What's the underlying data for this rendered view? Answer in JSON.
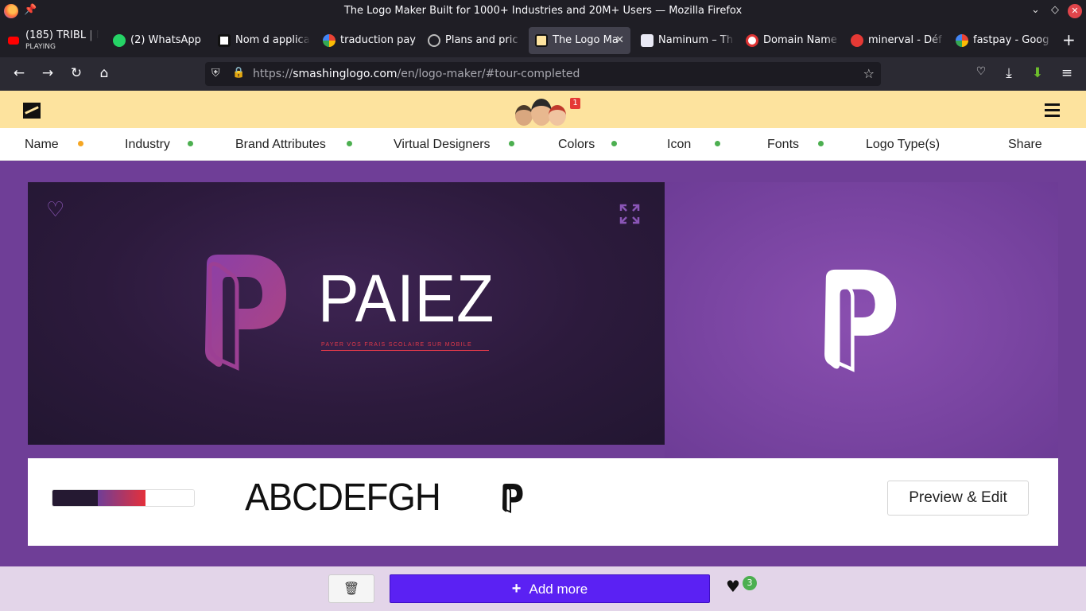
{
  "window": {
    "title": "The Logo Maker Built for 1000+ Industries and 20M+ Users — Mozilla Firefox",
    "controls": [
      "chevron-down",
      "restore",
      "close"
    ]
  },
  "tabs": [
    {
      "label": "(185) TRIBL | N",
      "sub": "PLAYING",
      "favicon": "youtube-icon",
      "color": "#ff0000"
    },
    {
      "label": "(2) WhatsApp",
      "favicon": "whatsapp-icon",
      "color": "#25d366"
    },
    {
      "label": "Nom d applica",
      "favicon": "app-icon",
      "color": "#ffffff"
    },
    {
      "label": "traduction pay",
      "favicon": "google-icon",
      "color": "#4285f4"
    },
    {
      "label": "Plans and pric",
      "favicon": "plans-icon",
      "color": "#333333"
    },
    {
      "label": "The Logo Ma",
      "favicon": "smashinglogo-icon",
      "color": "#fde39e",
      "active": true
    },
    {
      "label": "Naminum – Th",
      "favicon": "naminum-icon",
      "color": "#e9e9f5"
    },
    {
      "label": "Domain Name",
      "favicon": "domain-icon",
      "color": "#ffffff"
    },
    {
      "label": "minerval - Déf",
      "favicon": "minerval-icon",
      "color": "#e53935"
    },
    {
      "label": "fastpay - Goog",
      "favicon": "google-icon",
      "color": "#4285f4"
    }
  ],
  "url": {
    "prefix": "https://",
    "domain": "smashinglogo.com",
    "path": "/en/logo-maker/#tour-completed"
  },
  "header": {
    "notification_count": "1"
  },
  "steps": [
    {
      "label": "Name",
      "dot": "#f5a623"
    },
    {
      "label": "Industry",
      "dot": "#4caf50"
    },
    {
      "label": "Brand Attributes",
      "dot": "#4caf50"
    },
    {
      "label": "Virtual Designers",
      "dot": "#4caf50"
    },
    {
      "label": "Colors",
      "dot": "#4caf50"
    },
    {
      "label": "Icon",
      "dot": "#4caf50"
    },
    {
      "label": "Fonts",
      "dot": "#4caf50"
    },
    {
      "label": "Logo Type(s)",
      "dot": null
    },
    {
      "label": "Share",
      "dot": null
    }
  ],
  "logo": {
    "brand_name": "PAIEZ",
    "tagline": "PAYER VOS FRAIS SCOLAIRE SUR MOBILE"
  },
  "colors": {
    "accent_purple": "#6f3e97",
    "palette": [
      "#251932",
      "#9b2c6f",
      "#e4303a",
      "#ffffff"
    ]
  },
  "details": {
    "font_sample": "ABCDEFGH",
    "preview_button": "Preview & Edit"
  },
  "footer": {
    "add_more": "Add more",
    "favorites_count": "3"
  }
}
